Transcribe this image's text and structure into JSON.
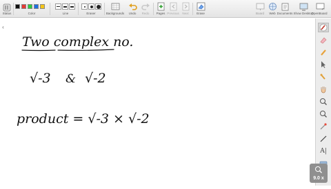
{
  "toolbar": {
    "groups": {
      "status": "Status",
      "color": "Color",
      "line": "Line",
      "eraser": "Eraser",
      "backgrounds": "Backgrounds",
      "undo": "Undo",
      "redo": "Redo",
      "pages": "Pages",
      "previous": "Previous",
      "next": "Next",
      "erase": "Erase",
      "board": "Board",
      "web": "Web",
      "documents": "Documents",
      "show_desktop": "Show Desktop",
      "openboard": "OpenBoard"
    },
    "colors": [
      "#111111",
      "#e53935",
      "#2ecc40",
      "#1e6fe0",
      "#f5c518"
    ]
  },
  "canvas": {
    "line1": "Two complex no.",
    "line2_left": "√-3",
    "line2_amp": "&",
    "line2_right": "√-2",
    "line3": "product = √-3 × √-2"
  },
  "zoom": {
    "value": "9.0 x"
  }
}
